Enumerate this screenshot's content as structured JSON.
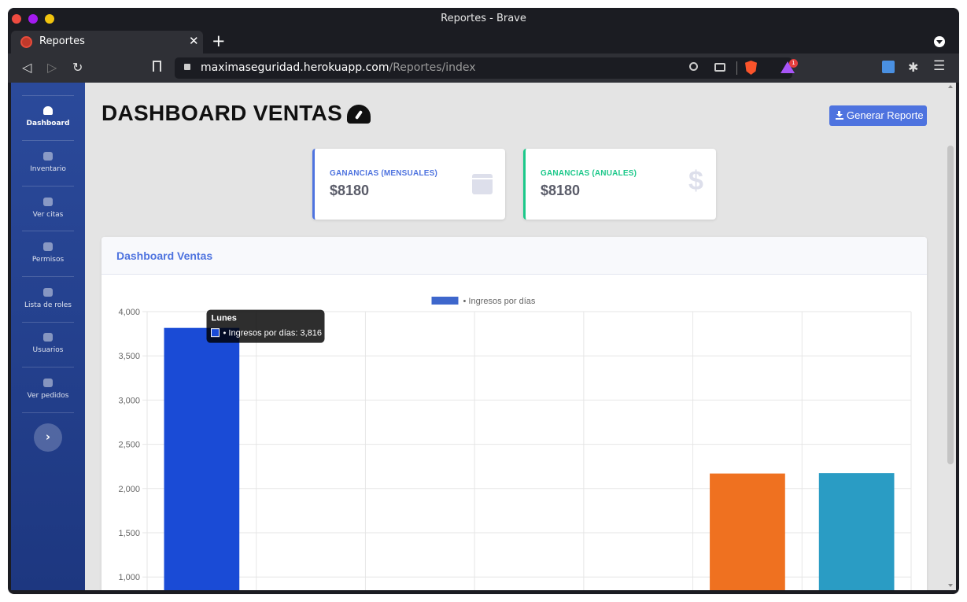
{
  "window": {
    "title": "Reportes - Brave"
  },
  "tab": {
    "label": "Reportes",
    "close": "✕",
    "new": "+"
  },
  "nav": {
    "back": "◁",
    "forward": "▷",
    "reload": "↻"
  },
  "url": {
    "domain": "maximaseguridad.herokuapp.com",
    "path": "/Reportes/index"
  },
  "extensions": {
    "rewards_badge": "1",
    "puzzle": "✱",
    "menu": "☰"
  },
  "sidebar": {
    "items": [
      {
        "label": "Dashboard",
        "icon": "gauge-icon"
      },
      {
        "label": "Inventario",
        "icon": "boxes-icon"
      },
      {
        "label": "Ver citas",
        "icon": "clipboard-icon"
      },
      {
        "label": "Permisos",
        "icon": "user-cog-icon"
      },
      {
        "label": "Lista de roles",
        "icon": "roles-icon"
      },
      {
        "label": "Usuarios",
        "icon": "users-icon"
      },
      {
        "label": "Ver pedidos",
        "icon": "qrcode-icon"
      }
    ],
    "toggle": "›"
  },
  "header": {
    "title": "DASHBOARD VENTAS",
    "report_button": "Generar Reporte"
  },
  "cards": [
    {
      "label": "GANANCIAS (MENSUALES)",
      "value": "$8180",
      "icon": "calendar-icon",
      "accent": "#4e73df"
    },
    {
      "label": "GANANCIAS (ANUALES)",
      "value": "$8180",
      "icon": "dollar-icon",
      "dollar_glyph": "$",
      "accent": "#1cc88a"
    }
  ],
  "panel": {
    "title": "Dashboard Ventas"
  },
  "chart_data": {
    "type": "bar",
    "legend": "• Ingresos por días",
    "legend_color": "#3e67cc",
    "categories": [
      "Lunes",
      "",
      "",
      "",
      "",
      "",
      ""
    ],
    "values": [
      3816,
      null,
      null,
      null,
      null,
      2170,
      2175
    ],
    "colors": [
      "#1a4bd6",
      "#cccccc",
      "#cccccc",
      "#cccccc",
      "#cccccc",
      "#ef7120",
      "#2a9cc4"
    ],
    "y_ticks": [
      1000,
      1500,
      2000,
      2500,
      3000,
      3500,
      4000
    ],
    "y_tick_labels": [
      "1,000",
      "1,500",
      "2,000",
      "2,500",
      "3,000",
      "3,500",
      "4,000"
    ],
    "ylim": [
      1000,
      4000
    ],
    "grid": true,
    "tooltip": {
      "title": "Lunes",
      "body": "• Ingresos por días: 3,816"
    }
  },
  "scroll_top": "⌃"
}
